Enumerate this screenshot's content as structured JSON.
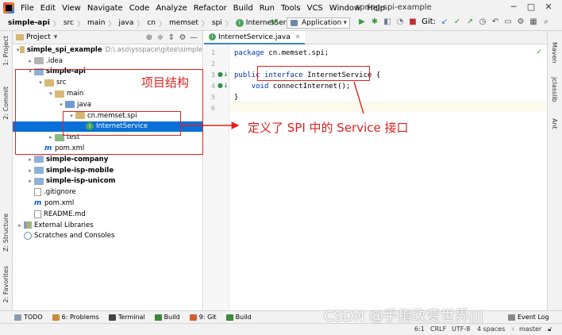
{
  "window": {
    "title": "spring-spi-example",
    "menu": [
      "File",
      "Edit",
      "View",
      "Navigate",
      "Code",
      "Analyze",
      "Refactor",
      "Build",
      "Run",
      "Tools",
      "VCS",
      "Window",
      "Help"
    ],
    "controls": [
      "─",
      "▢",
      "✕"
    ]
  },
  "navbar": {
    "breadcrumbs": [
      "simple-api",
      "src",
      "main",
      "java",
      "cn",
      "memset",
      "spi",
      "InternetService"
    ],
    "run_config": "Application",
    "git_label": "Git:"
  },
  "left_tabs": [
    "1: Project",
    "2: Commit",
    "Z: Structure",
    "2: Favorites"
  ],
  "right_tabs": [
    "Maven",
    "jclasslib",
    "Ant"
  ],
  "project_panel": {
    "title": "Project",
    "tree": [
      {
        "label": "simple_spi_example",
        "path": "D:\\.aso\\ysspace\\gitee\\simple",
        "level": 0,
        "arrow": "▾",
        "icon": "folder",
        "bold": true
      },
      {
        "label": ".idea",
        "level": 1,
        "arrow": "▸",
        "icon": "folder-idea"
      },
      {
        "label": "simple-api",
        "level": 1,
        "arrow": "▾",
        "icon": "folder-module",
        "bold": true
      },
      {
        "label": "src",
        "level": 2,
        "arrow": "▾",
        "icon": "folder"
      },
      {
        "label": "main",
        "level": 3,
        "arrow": "▾",
        "icon": "folder"
      },
      {
        "label": "java",
        "level": 4,
        "arrow": "▾",
        "icon": "folder-src"
      },
      {
        "label": "cn.memset.spi",
        "level": 5,
        "arrow": "▾",
        "icon": "folder"
      },
      {
        "label": "InternetService",
        "level": 6,
        "arrow": "",
        "icon": "interface",
        "selected": true
      },
      {
        "label": "test",
        "level": 3,
        "arrow": "▸",
        "icon": "folder-test"
      },
      {
        "label": "pom.xml",
        "level": 2,
        "arrow": "",
        "icon": "maven"
      },
      {
        "label": "simple-company",
        "level": 1,
        "arrow": "▸",
        "icon": "folder-module",
        "bold": true
      },
      {
        "label": "simple-isp-mobile",
        "level": 1,
        "arrow": "▸",
        "icon": "folder-module",
        "bold": true
      },
      {
        "label": "simple-isp-unicom",
        "level": 1,
        "arrow": "▸",
        "icon": "folder-module",
        "bold": true
      },
      {
        "label": ".gitignore",
        "level": 1,
        "arrow": "",
        "icon": "file"
      },
      {
        "label": "pom.xml",
        "level": 1,
        "arrow": "",
        "icon": "maven"
      },
      {
        "label": "README.md",
        "level": 1,
        "arrow": "",
        "icon": "file"
      },
      {
        "label": "External Libraries",
        "level": 0,
        "arrow": "▸",
        "icon": "library"
      },
      {
        "label": "Scratches and Consoles",
        "level": 0,
        "arrow": "",
        "icon": "scratch"
      }
    ]
  },
  "editor": {
    "tab_label": "InternetService.java",
    "lines": [
      {
        "n": "1",
        "tokens": [
          {
            "t": "package",
            "k": true
          },
          {
            "t": " cn.memset.spi;",
            "k": false
          }
        ]
      },
      {
        "n": "2",
        "tokens": []
      },
      {
        "n": "3",
        "tokens": [
          {
            "t": "public",
            "k": true
          },
          {
            "t": " ",
            "k": false
          },
          {
            "t": "interface",
            "k": true
          },
          {
            "t": " InternetService {",
            "k": false
          }
        ]
      },
      {
        "n": "4",
        "tokens": [
          {
            "t": "    ",
            "k": false
          },
          {
            "t": "void",
            "k": true
          },
          {
            "t": " connectInternet();",
            "k": false
          }
        ]
      },
      {
        "n": "5",
        "tokens": [
          {
            "t": "}",
            "k": false
          }
        ]
      },
      {
        "n": "6",
        "tokens": []
      }
    ]
  },
  "annotations": {
    "structure_label": "项目结构",
    "spi_label": "定义了 SPI 中的 Service 接口"
  },
  "bottom_tools": [
    "TODO",
    "6: Problems",
    "Terminal",
    "Build",
    "9: Git",
    "Build"
  ],
  "status": {
    "position": "6:1",
    "line_sep": "CRLF",
    "encoding": "UTF-8",
    "indent": "4 spaces",
    "branch": "master",
    "event_log": "Event Log"
  },
  "watermark": "CSDN @手指改变世界|||"
}
